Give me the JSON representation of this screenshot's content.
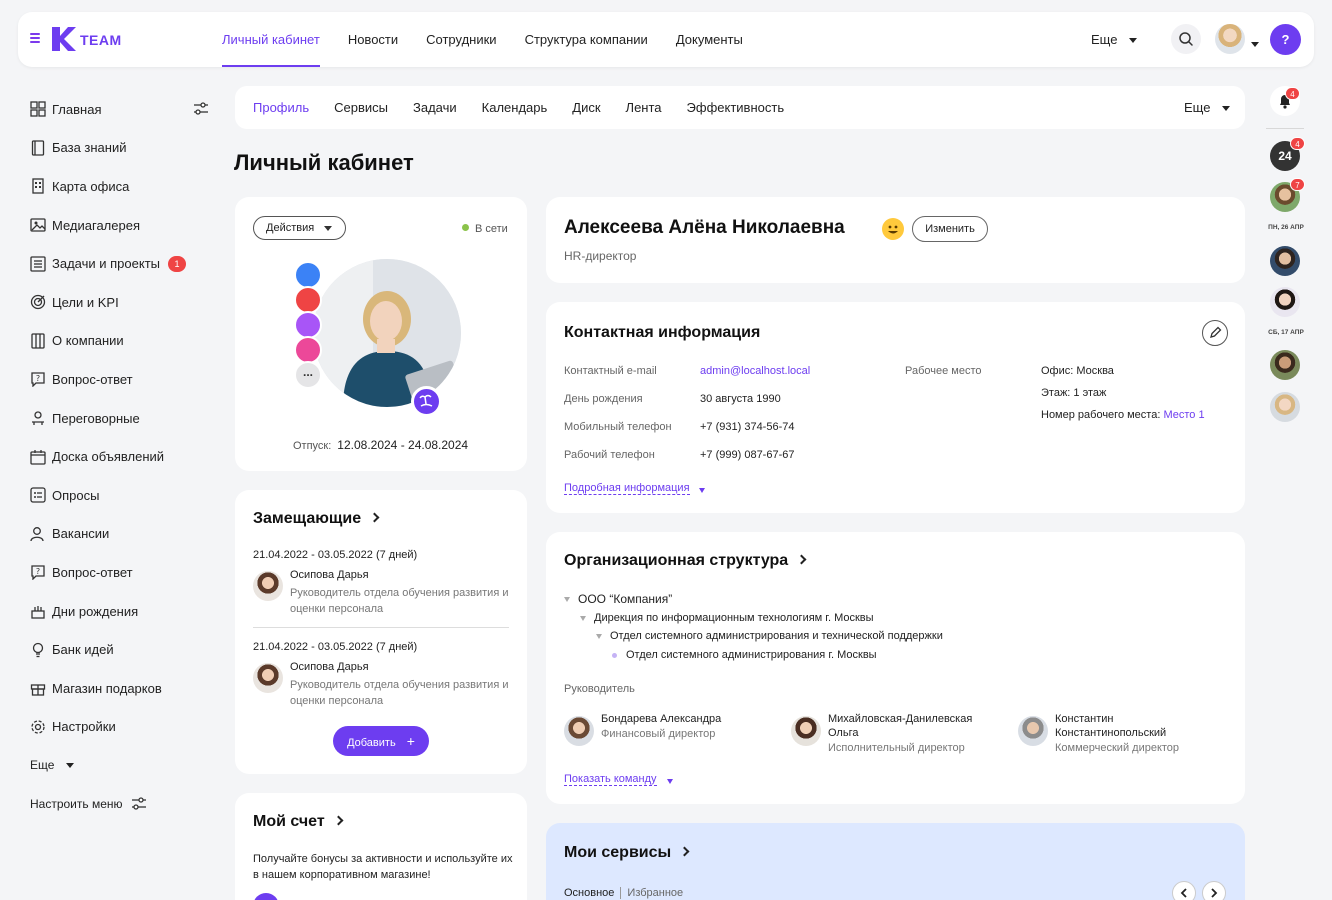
{
  "app": {
    "logo_text": "TEAM",
    "accent_color": "#6d3df0",
    "badge_color": "#ef4444"
  },
  "topnav": {
    "items": [
      "Личный кабинет",
      "Новости",
      "Сотрудники",
      "Структура компании",
      "Документы"
    ],
    "active_index": 0,
    "more_label": "Еще",
    "help_label": "?"
  },
  "sidebar": {
    "items": [
      {
        "label": "Главная",
        "icon": "grid-icon"
      },
      {
        "label": "База знаний",
        "icon": "book-icon"
      },
      {
        "label": "Карта офиса",
        "icon": "building-icon"
      },
      {
        "label": "Медиагалерея",
        "icon": "image-icon"
      },
      {
        "label": "Задачи и проекты",
        "icon": "checklist-icon",
        "badge": "1"
      },
      {
        "label": "Цели и KPI",
        "icon": "target-icon"
      },
      {
        "label": "О компании",
        "icon": "office-icon"
      },
      {
        "label": "Вопрос-ответ",
        "icon": "question-icon"
      },
      {
        "label": "Переговорные",
        "icon": "meeting-icon"
      },
      {
        "label": "Доска объявлений",
        "icon": "board-icon"
      },
      {
        "label": "Опросы",
        "icon": "poll-icon"
      },
      {
        "label": "Вакансии",
        "icon": "user-icon"
      },
      {
        "label": "Вопрос-ответ",
        "icon": "question-icon"
      },
      {
        "label": "Дни рождения",
        "icon": "cake-icon"
      },
      {
        "label": "Банк идей",
        "icon": "bulb-icon"
      },
      {
        "label": "Магазин подарков",
        "icon": "gift-icon"
      },
      {
        "label": "Настройки",
        "icon": "gear-icon"
      }
    ],
    "more_label": "Еще",
    "configure_label": "Настроить меню"
  },
  "subnav": {
    "items": [
      "Профиль",
      "Сервисы",
      "Задачи",
      "Календарь",
      "Диск",
      "Лента",
      "Эффективность"
    ],
    "active_index": 0,
    "more_label": "Еще"
  },
  "page_title": "Личный кабинет",
  "profile": {
    "actions_label": "Действия",
    "status": "В сети",
    "vacation_label": "Отпуск:",
    "vacation_value": "12.08.2024 - 24.08.2024",
    "name": "Алексеева Алёна Николаевна",
    "edit_label": "Изменить",
    "position": "HR-директор",
    "more_achievements": "..."
  },
  "deputies": {
    "title": "Замещающие",
    "entries": [
      {
        "dates": "21.04.2022 - 03.05.2022 (7 дней)",
        "name": "Осипова Дарья",
        "role": "Руководитель отдела обучения развития и оценки персонала"
      },
      {
        "dates": "21.04.2022 - 03.05.2022 (7 дней)",
        "name": "Осипова Дарья",
        "role": "Руководитель отдела обучения развития и оценки персонала"
      }
    ],
    "add_label": "Добавить",
    "add_symbol": "+"
  },
  "account": {
    "title": "Мой счет",
    "text": "Получайте бонусы за активности и используйте их в нашем корпоративном магазине!"
  },
  "contacts": {
    "title": "Контактная информация",
    "rows": [
      {
        "label": "Контактный e-mail",
        "value": "admin@localhost.local"
      },
      {
        "label": "День рождения",
        "value": "30 августа 1990"
      },
      {
        "label": "Мобильный телефон",
        "value": "+7 (931) 374-56-74"
      },
      {
        "label": "Рабочий телефон",
        "value": "+7 (999) 087-67-67"
      }
    ],
    "workplace_label": "Рабочее место",
    "office": "Офис: Москва",
    "floor": "Этаж: 1 этаж",
    "seat_label": "Номер рабочего места:",
    "seat_value": "Место 1",
    "details_link": "Подробная информация"
  },
  "org": {
    "title": "Организационная структура",
    "tree": [
      "ООО “Компания”",
      "Дирекция по информационным технологиям г. Москвы",
      "Отдел системного администрирования и технической поддержки",
      "Отдел системного администрирования г. Москвы"
    ],
    "managers_label": "Руководитель",
    "managers": [
      {
        "name": "Бондарева Александра",
        "role": "Финансовый директор"
      },
      {
        "name": "Михайловская-Данилевская Ольга",
        "role": "Исполнительный директор"
      },
      {
        "name": "Константин Константинопольский",
        "role": "Коммерческий директор"
      }
    ],
    "team_link": "Показать команду"
  },
  "services": {
    "title": "Мои сервисы",
    "tab_main": "Основное",
    "tab_fav": "Избранное"
  },
  "rail": {
    "notif_badge": "4",
    "chat_label": "24",
    "chat_badge": "4",
    "user_badge": "7",
    "date1": "ПН, 26 АПР",
    "date2": "СБ, 17 АПР"
  }
}
